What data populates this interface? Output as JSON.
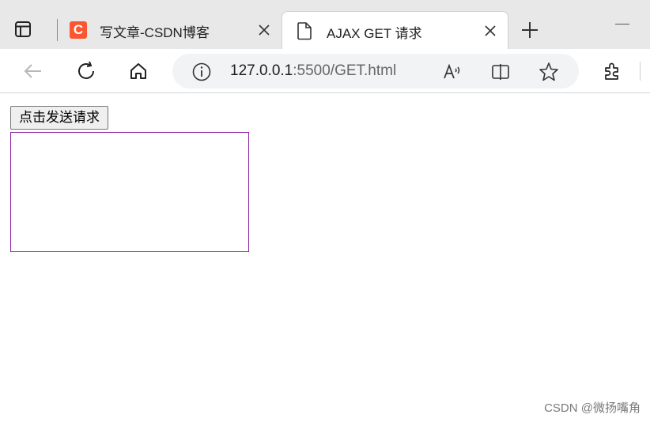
{
  "browser": {
    "tabs": [
      {
        "title": "写文章-CSDN博客",
        "favicon": "csdn-logo",
        "active": false
      },
      {
        "title": "AJAX GET 请求",
        "favicon": "document-icon",
        "active": true
      }
    ],
    "address": {
      "host": "127.0.0.1",
      "rest": ":5500/GET.html"
    }
  },
  "page": {
    "button_label": "点击发送请求",
    "result_text": "",
    "result_border_color": "#8a1fa0"
  },
  "watermark": "CSDN @微扬嘴角",
  "icons": {
    "favicon_letter": "C"
  }
}
